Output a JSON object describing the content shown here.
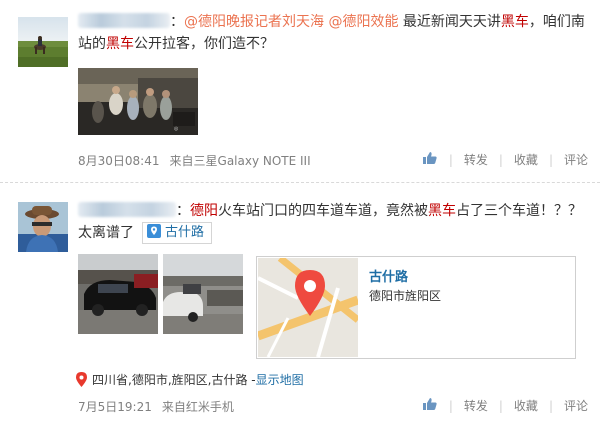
{
  "posts": [
    {
      "text": {
        "colon": "：",
        "mention1": "@德阳晚报记者刘天海",
        "mention2": "@德阳效能",
        "part1": " 最近新闻天天讲",
        "kw1": "黑车",
        "part2": "，咱们南站的",
        "kw2": "黑车",
        "part3": "公开拉客，你们造不？"
      },
      "time": "8月30日08:41",
      "from_label": "来自",
      "device": "三星Galaxy NOTE III",
      "actions": {
        "forward": "转发",
        "favorite": "收藏",
        "comment": "评论"
      }
    },
    {
      "text": {
        "colon": "：",
        "kw1": "德阳",
        "part1": "火车站门口的四车道车道，竟然被",
        "kw2": "黑车",
        "part2": "占了三个车道！？？太离谱了"
      },
      "location_tag": "古什路",
      "map_card": {
        "title": "古什路",
        "address": "德阳市旌阳区"
      },
      "location_line": {
        "text": "四川省,德阳市,旌阳区,古什路 - ",
        "show_map": "显示地图"
      },
      "time": "7月5日19:21",
      "from_label": "来自",
      "device": "红米手机",
      "actions": {
        "forward": "转发",
        "favorite": "收藏",
        "comment": "评论"
      }
    }
  ],
  "colors": {
    "link": "#eb7350",
    "keyword": "#c00000",
    "blue": "#1f6ea5",
    "meta": "#808080"
  },
  "icons": [
    "like-icon",
    "location-pin-icon",
    "map-marker-icon"
  ]
}
